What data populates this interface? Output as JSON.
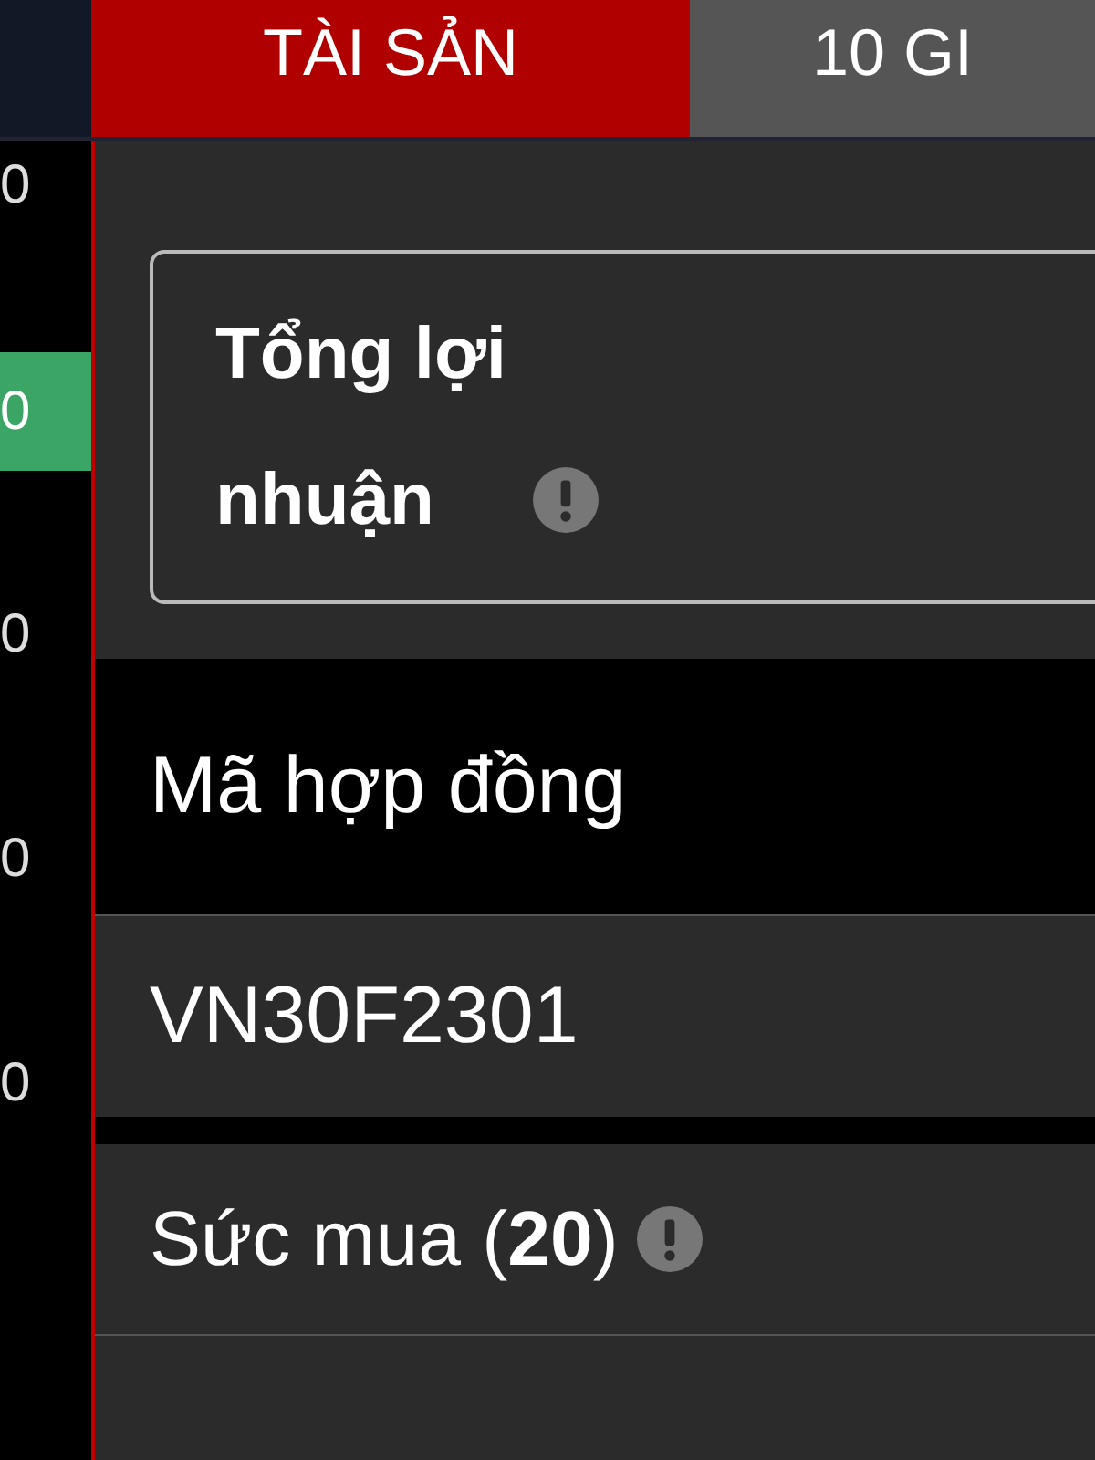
{
  "tabs": [
    {
      "label": "TÀI SẢN",
      "selected": true
    },
    {
      "label": "10 GI",
      "selected": false
    }
  ],
  "side_values": [
    {
      "text": "0",
      "highlighted": false
    },
    {
      "text": "0",
      "highlighted": true
    },
    {
      "text": "0",
      "highlighted": false
    },
    {
      "text": "0",
      "highlighted": false
    },
    {
      "text": "0",
      "highlighted": false
    }
  ],
  "profit_card": {
    "title": "Tổng lợi nhuận"
  },
  "contract_header": "Mã hợp đồng",
  "contract": "VN30F2301",
  "buying_power": {
    "label": "Sức mua (**20**)"
  }
}
